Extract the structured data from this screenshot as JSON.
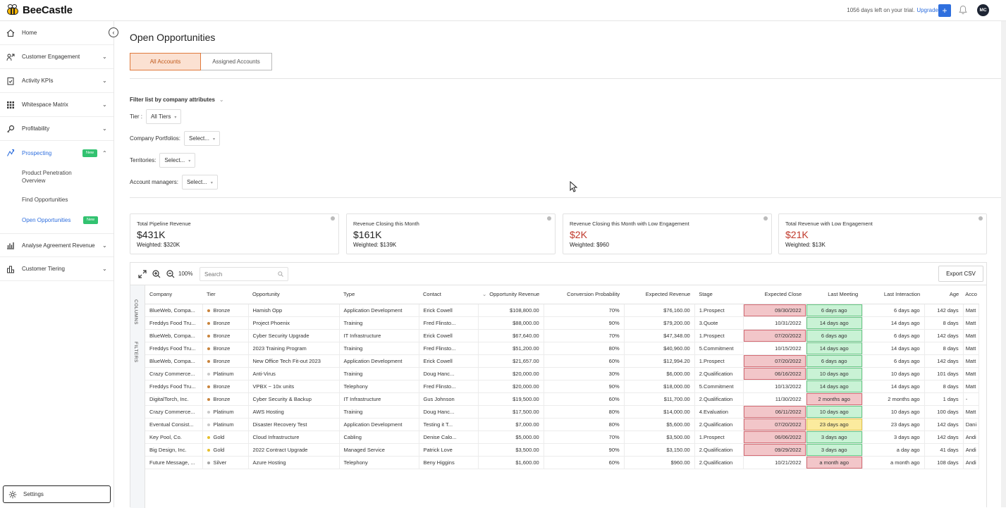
{
  "app": {
    "brand": "BeeCastle",
    "trial_text": "1056 days left on your trial.",
    "upgrade_label": "Upgrade",
    "plus_label": "+",
    "user_initials": "MC"
  },
  "sidebar": {
    "items": [
      {
        "label": "Home",
        "icon": "home-icon"
      },
      {
        "label": "Customer Engagement",
        "icon": "engagement-icon"
      },
      {
        "label": "Activity KPIs",
        "icon": "clipboard-check-icon"
      },
      {
        "label": "Whitespace Matrix",
        "icon": "grid-icon"
      },
      {
        "label": "Profitability",
        "icon": "key-icon"
      },
      {
        "label": "Prospecting",
        "icon": "prospecting-icon",
        "badge": "New"
      },
      {
        "label": "Analyse Agreement Revenue",
        "icon": "bar-chart-icon"
      },
      {
        "label": "Customer Tiering",
        "icon": "tiering-icon"
      }
    ],
    "sub_items": [
      {
        "label": "Product Penetration Overview"
      },
      {
        "label": "Find Opportunities"
      },
      {
        "label": "Open Opportunities",
        "badge": "New"
      }
    ],
    "settings_label": "Settings"
  },
  "page": {
    "title": "Open Opportunities",
    "tabs": [
      {
        "label": "All Accounts",
        "active": true
      },
      {
        "label": "Assigned Accounts",
        "active": false
      }
    ],
    "filter_title": "Filter list by company attributes",
    "filters": [
      {
        "label": "Tier :",
        "value": "All Tiers"
      },
      {
        "label": "Company Portfolios:",
        "value": "Select..."
      },
      {
        "label": "Territories:",
        "value": "Select..."
      },
      {
        "label": "Account managers:",
        "value": "Select..."
      }
    ]
  },
  "cards": [
    {
      "title": "Total Pipeline Revenue",
      "value": "$431K",
      "weighted": "Weighted: $320K",
      "alert": false
    },
    {
      "title": "Revenue Closing this Month",
      "value": "$161K",
      "weighted": "Weighted: $139K",
      "alert": false
    },
    {
      "title": "Revenue Closing this Month with Low Engagement",
      "value": "$2K",
      "weighted": "Weighted: $960",
      "alert": true
    },
    {
      "title": "Total Revenue with Low Engagement",
      "value": "$21K",
      "weighted": "Weighted: $13K",
      "alert": true
    }
  ],
  "grid": {
    "zoom": "100%",
    "search_placeholder": "Search",
    "export_label": "Export CSV",
    "side_tabs": [
      "COLUMNS",
      "FILTERS"
    ],
    "columns": [
      "Company",
      "Tier",
      "Opportunity",
      "Type",
      "Contact",
      "Opportunity Revenue",
      "Conversion Probability",
      "Expected Revenue",
      "Stage",
      "Expected Close",
      "Last Meeting",
      "Last Interaction",
      "Age",
      "Acco"
    ],
    "tier_colors": {
      "Bronze": "#c9843c",
      "Platinum": "#c8c8c8",
      "Gold": "#e6bf2b",
      "Silver": "#a6a6a6"
    },
    "rows": [
      {
        "company": "BlueWeb, Compa...",
        "tier": "Bronze",
        "opportunity": "Hamish Opp",
        "type": "Application Development",
        "contact": "Erick Cowell",
        "revenue": "$108,800.00",
        "prob": "70%",
        "expected": "$76,160.00",
        "stage": "1.Prospect",
        "close": "09/30/2022",
        "close_hl": "red",
        "meeting": "6 days ago",
        "meeting_hl": "green",
        "interaction": "6 days ago",
        "age": "142 days",
        "acct": "Matt"
      },
      {
        "company": "Freddys Food Tru...",
        "tier": "Bronze",
        "opportunity": "Project Phoenix",
        "type": "Training",
        "contact": "Fred Flinsto...",
        "revenue": "$88,000.00",
        "prob": "90%",
        "expected": "$79,200.00",
        "stage": "3.Quote",
        "close": "10/31/2022",
        "close_hl": "",
        "meeting": "14 days ago",
        "meeting_hl": "green",
        "interaction": "14 days ago",
        "age": "8 days",
        "acct": "Matt"
      },
      {
        "company": "BlueWeb, Compa...",
        "tier": "Bronze",
        "opportunity": "Cyber Security Upgrade",
        "type": "IT Infrastructure",
        "contact": "Erick Cowell",
        "revenue": "$67,640.00",
        "prob": "70%",
        "expected": "$47,348.00",
        "stage": "1.Prospect",
        "close": "07/20/2022",
        "close_hl": "red",
        "meeting": "6 days ago",
        "meeting_hl": "green",
        "interaction": "6 days ago",
        "age": "142 days",
        "acct": "Matt"
      },
      {
        "company": "Freddys Food Tru...",
        "tier": "Bronze",
        "opportunity": "2023 Training Program",
        "type": "Training",
        "contact": "Fred Flinsto...",
        "revenue": "$51,200.00",
        "prob": "80%",
        "expected": "$40,960.00",
        "stage": "5.Commitment",
        "close": "10/15/2022",
        "close_hl": "",
        "meeting": "14 days ago",
        "meeting_hl": "green",
        "interaction": "14 days ago",
        "age": "8 days",
        "acct": "Matt"
      },
      {
        "company": "BlueWeb, Compa...",
        "tier": "Bronze",
        "opportunity": "New Office Tech Fit-out 2023",
        "type": "Application Development",
        "contact": "Erick Cowell",
        "revenue": "$21,657.00",
        "prob": "60%",
        "expected": "$12,994.20",
        "stage": "1.Prospect",
        "close": "07/20/2022",
        "close_hl": "red",
        "meeting": "6 days ago",
        "meeting_hl": "green",
        "interaction": "6 days ago",
        "age": "142 days",
        "acct": "Matt"
      },
      {
        "company": "Crazy Commerce...",
        "tier": "Platinum",
        "opportunity": "Anti-Virus",
        "type": "Training",
        "contact": "Doug Hanc...",
        "revenue": "$20,000.00",
        "prob": "30%",
        "expected": "$6,000.00",
        "stage": "2.Qualification",
        "close": "06/16/2022",
        "close_hl": "red",
        "meeting": "10 days ago",
        "meeting_hl": "green",
        "interaction": "10 days ago",
        "age": "101 days",
        "acct": "Matt"
      },
      {
        "company": "Freddys Food Tru...",
        "tier": "Bronze",
        "opportunity": "VPBX ~ 10x units",
        "type": "Telephony",
        "contact": "Fred Flinsto...",
        "revenue": "$20,000.00",
        "prob": "90%",
        "expected": "$18,000.00",
        "stage": "5.Commitment",
        "close": "10/13/2022",
        "close_hl": "",
        "meeting": "14 days ago",
        "meeting_hl": "green",
        "interaction": "14 days ago",
        "age": "8 days",
        "acct": "Matt"
      },
      {
        "company": "DigitalTorch, Inc.",
        "tier": "Bronze",
        "opportunity": "Cyber Security & Backup",
        "type": "IT Infrastructure",
        "contact": "Gus Johnson",
        "revenue": "$19,500.00",
        "prob": "60%",
        "expected": "$11,700.00",
        "stage": "2.Qualification",
        "close": "11/30/2022",
        "close_hl": "",
        "meeting": "2 months ago",
        "meeting_hl": "red",
        "interaction": "2 months ago",
        "age": "1 days",
        "acct": "-"
      },
      {
        "company": "Crazy Commerce...",
        "tier": "Platinum",
        "opportunity": "AWS Hosting",
        "type": "Training",
        "contact": "Doug Hanc...",
        "revenue": "$17,500.00",
        "prob": "80%",
        "expected": "$14,000.00",
        "stage": "4.Evaluation",
        "close": "06/11/2022",
        "close_hl": "red",
        "meeting": "10 days ago",
        "meeting_hl": "green",
        "interaction": "10 days ago",
        "age": "100 days",
        "acct": "Matt"
      },
      {
        "company": "Eventual Consist...",
        "tier": "Platinum",
        "opportunity": "Disaster Recovery Test",
        "type": "Application Development",
        "contact": "Testing it T...",
        "revenue": "$7,000.00",
        "prob": "80%",
        "expected": "$5,600.00",
        "stage": "2.Qualification",
        "close": "07/20/2022",
        "close_hl": "red",
        "meeting": "23 days ago",
        "meeting_hl": "yellow",
        "interaction": "23 days ago",
        "age": "142 days",
        "acct": "Dani"
      },
      {
        "company": "Key Pool, Co.",
        "tier": "Gold",
        "opportunity": "Cloud Infrastructure",
        "type": "Cabling",
        "contact": "Denise Calo...",
        "revenue": "$5,000.00",
        "prob": "70%",
        "expected": "$3,500.00",
        "stage": "1.Prospect",
        "close": "06/06/2022",
        "close_hl": "red",
        "meeting": "3 days ago",
        "meeting_hl": "green",
        "interaction": "3 days ago",
        "age": "142 days",
        "acct": "Andi"
      },
      {
        "company": "Big Design, Inc.",
        "tier": "Gold",
        "opportunity": "2022 Contract Upgrade",
        "type": "Managed Service",
        "contact": "Patrick Love",
        "revenue": "$3,500.00",
        "prob": "90%",
        "expected": "$3,150.00",
        "stage": "2.Qualification",
        "close": "09/29/2022",
        "close_hl": "red",
        "meeting": "3 days ago",
        "meeting_hl": "green",
        "interaction": "a day ago",
        "age": "41 days",
        "acct": "Andi"
      },
      {
        "company": "Future Message, ...",
        "tier": "Silver",
        "opportunity": "Azure Hosting",
        "type": "Telephony",
        "contact": "Beny Higgins",
        "revenue": "$1,600.00",
        "prob": "60%",
        "expected": "$960.00",
        "stage": "2.Qualification",
        "close": "10/21/2022",
        "close_hl": "",
        "meeting": "a month ago",
        "meeting_hl": "red",
        "interaction": "a month ago",
        "age": "108 days",
        "acct": "Andi"
      }
    ]
  }
}
